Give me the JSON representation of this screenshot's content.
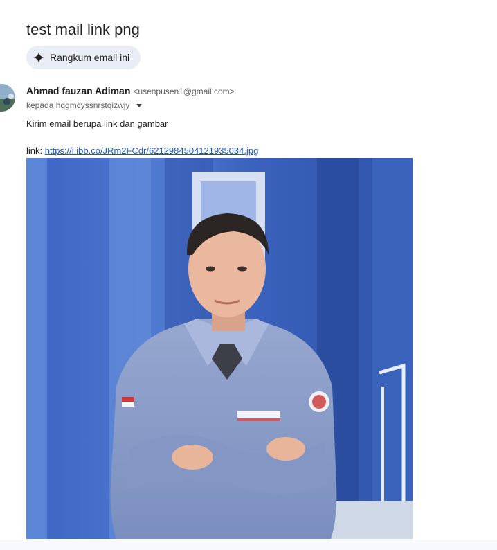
{
  "email": {
    "subject": "test mail link png",
    "summarize_label": "Rangkum email ini",
    "sender": {
      "name": "Ahmad fauzan Adiman",
      "email": "<usenpusen1@gmail.com>"
    },
    "recipient_line": "kepada hqgmcyssnrstqizwjy",
    "body": {
      "line1": "Kirim email berupa link dan gambar",
      "link_prefix": "link: ",
      "link_url": "https://i.ibb.co/JRm2FCdr/6212984504121935034.jpg"
    },
    "attachment_image": {
      "description_icon": "photo"
    }
  },
  "colors": {
    "link": "#1a57c8",
    "chip_bg": "#e9eef6",
    "shirt": "#8a9cc4",
    "wall_blue": "#3f6ec6"
  }
}
